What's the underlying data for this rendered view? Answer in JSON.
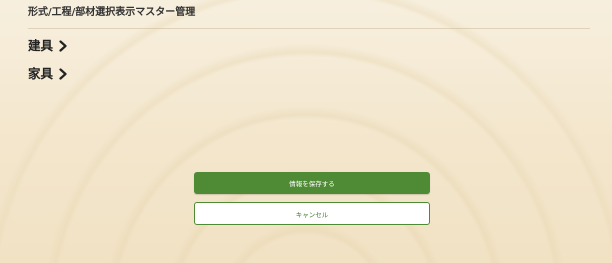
{
  "header": {
    "title": "形式/工程/部材選択表示マスター管理"
  },
  "sections": [
    {
      "label": "建具",
      "icon": "chevron-right-icon"
    },
    {
      "label": "家具",
      "icon": "chevron-right-icon"
    }
  ],
  "actions": {
    "save_label": "情報を保存する",
    "cancel_label": "キャンセル"
  },
  "colors": {
    "accent": "#4f8a34",
    "background": "#f4ead6"
  }
}
